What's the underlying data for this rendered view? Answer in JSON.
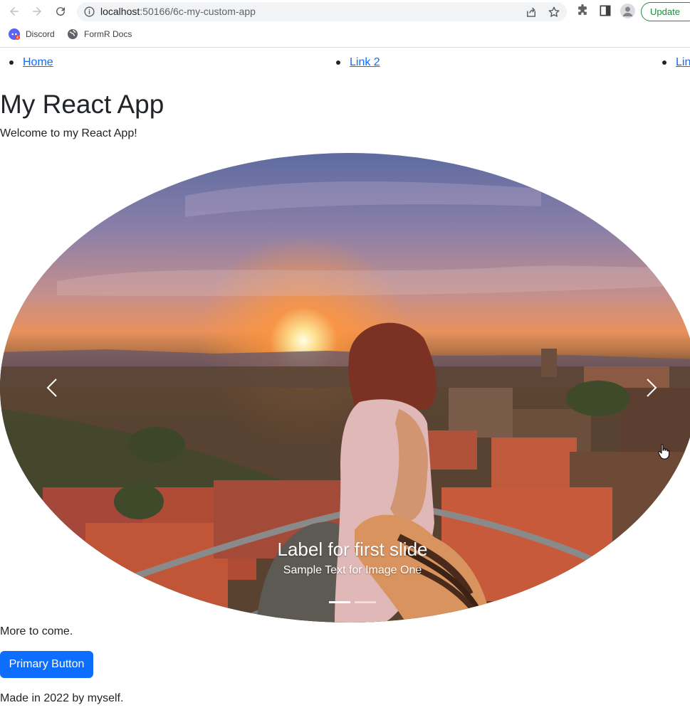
{
  "browser": {
    "url_host": "localhost",
    "url_path": ":50166/6c-my-custom-app",
    "update_label": "Update",
    "accent_green": "#1e8e3e",
    "icons": [
      "back-icon",
      "forward-icon",
      "reload-icon",
      "info-icon",
      "share-icon",
      "star-icon",
      "extensions-icon",
      "side-panel-icon",
      "profile-icon"
    ],
    "bookmarks": [
      {
        "label": "Discord",
        "icon": "discord-icon"
      },
      {
        "label": "FormR Docs",
        "icon": "globe-icon"
      }
    ]
  },
  "nav": {
    "links": [
      "Home",
      "Link 2",
      "Lin"
    ]
  },
  "page": {
    "title": "My React App",
    "welcome": "Welcome to my React App!",
    "more": "More to come.",
    "button_label": "Primary Button",
    "footer": "Made in 2022 by myself.",
    "link_color": "#0d6efd",
    "button_color": "#0d6efd"
  },
  "carousel": {
    "caption_title": "Label for first slide",
    "caption_text": "Sample Text for Image One",
    "slide_count": 2,
    "active_slide": 1
  }
}
